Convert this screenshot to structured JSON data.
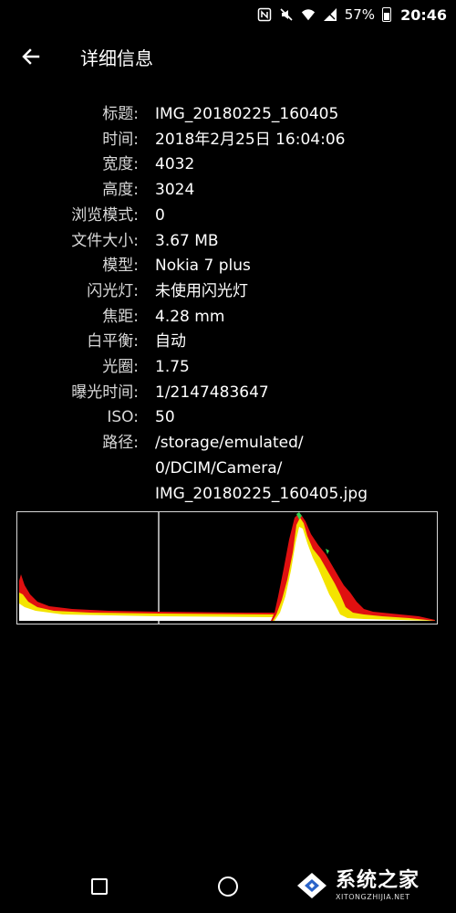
{
  "status_bar": {
    "battery_percent": "57%",
    "time": "20:46",
    "icons": [
      "nfc-icon",
      "mute-icon",
      "wifi-icon",
      "signal-icon",
      "battery-icon"
    ]
  },
  "app_bar": {
    "back_icon": "arrow-left-icon",
    "title": "详细信息"
  },
  "details": [
    {
      "label": "标题:",
      "value": [
        "IMG_20180225_160405"
      ]
    },
    {
      "label": "时间:",
      "value": [
        "2018年2月25日 16:04:06"
      ]
    },
    {
      "label": "宽度:",
      "value": [
        "4032"
      ]
    },
    {
      "label": "高度:",
      "value": [
        "3024"
      ]
    },
    {
      "label": "浏览模式:",
      "value": [
        "0"
      ]
    },
    {
      "label": "文件大小:",
      "value": [
        "3.67 MB"
      ]
    },
    {
      "label": "模型:",
      "value": [
        "Nokia 7 plus"
      ]
    },
    {
      "label": "闪光灯:",
      "value": [
        "未使用闪光灯"
      ]
    },
    {
      "label": "焦距:",
      "value": [
        "4.28 mm"
      ]
    },
    {
      "label": "白平衡:",
      "value": [
        "自动"
      ]
    },
    {
      "label": "光圈:",
      "value": [
        "1.75"
      ]
    },
    {
      "label": "曝光时间:",
      "value": [
        "1/2147483647"
      ]
    },
    {
      "label": "ISO:",
      "value": [
        "50"
      ]
    },
    {
      "label": "路径:",
      "value": [
        "/storage/emulated/",
        "0/DCIM/Camera/",
        "IMG_20180225_160405.jpg"
      ]
    }
  ],
  "histogram": {
    "colors": {
      "red": "#e01010",
      "yellow": "#f4e400",
      "white": "#ffffff",
      "green": "#30d050",
      "border": "#d8d8d8"
    }
  },
  "nav_bar": {
    "icons": [
      "recents-icon",
      "home-icon"
    ]
  },
  "watermark": {
    "title": "系统之家",
    "subtitle": "XITONGZHIJIA.NET"
  }
}
